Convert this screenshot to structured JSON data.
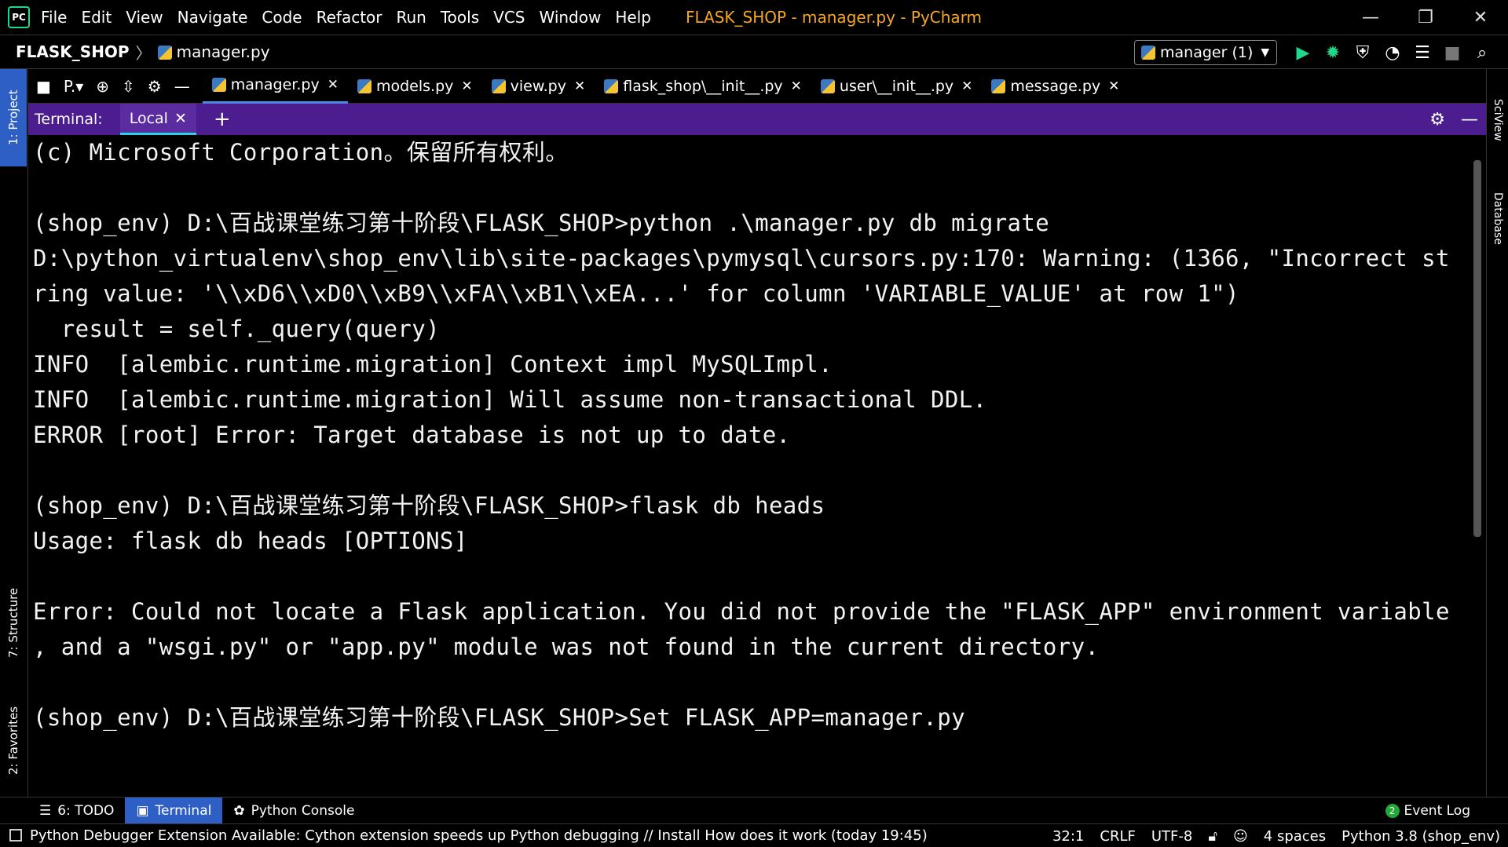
{
  "menubar": {
    "logo": "PC",
    "items": [
      "File",
      "Edit",
      "View",
      "Navigate",
      "Code",
      "Refactor",
      "Run",
      "Tools",
      "VCS",
      "Window",
      "Help"
    ],
    "window_title": "FLASK_SHOP - manager.py - PyCharm",
    "controls": [
      "—",
      "❐",
      "✕"
    ]
  },
  "navbar": {
    "project": "FLASK_SHOP",
    "separator": "〉",
    "file": "manager.py",
    "run_config": "manager (1)",
    "icons": [
      "run-icon",
      "debug-icon",
      "coverage-icon",
      "profile-icon",
      "build-icon",
      "stop-icon",
      "search-icon"
    ]
  },
  "left_stripe": {
    "project": "1: Project",
    "structure": "7: Structure",
    "favorites": "2: Favorites"
  },
  "right_stripe": {
    "sciview": "SciView",
    "database": "Database"
  },
  "tab_row": {
    "project_label": "P.▾",
    "tabs": [
      {
        "label": "manager.py",
        "active": true
      },
      {
        "label": "models.py",
        "active": false
      },
      {
        "label": "view.py",
        "active": false
      },
      {
        "label": "flask_shop\\__init__.py",
        "active": false
      },
      {
        "label": "user\\__init__.py",
        "active": false
      },
      {
        "label": "message.py",
        "active": false
      }
    ]
  },
  "terminal": {
    "label": "Terminal:",
    "tab": "Local",
    "lines": [
      "(c) Microsoft Corporation。保留所有权利。",
      "",
      "(shop_env) D:\\百战课堂练习第十阶段\\FLASK_SHOP>python .\\manager.py db migrate",
      "D:\\python_virtualenv\\shop_env\\lib\\site-packages\\pymysql\\cursors.py:170: Warning: (1366, \"Incorrect st",
      "ring value: '\\\\xD6\\\\xD0\\\\xB9\\\\xFA\\\\xB1\\\\xEA...' for column 'VARIABLE_VALUE' at row 1\")",
      "  result = self._query(query)",
      "INFO  [alembic.runtime.migration] Context impl MySQLImpl.",
      "INFO  [alembic.runtime.migration] Will assume non-transactional DDL.",
      "ERROR [root] Error: Target database is not up to date.",
      "",
      "(shop_env) D:\\百战课堂练习第十阶段\\FLASK_SHOP>flask db heads",
      "Usage: flask db heads [OPTIONS]",
      "",
      "Error: Could not locate a Flask application. You did not provide the \"FLASK_APP\" environment variable",
      ", and a \"wsgi.py\" or \"app.py\" module was not found in the current directory.",
      "",
      "(shop_env) D:\\百战课堂练习第十阶段\\FLASK_SHOP>Set FLASK_APP=manager.py"
    ]
  },
  "bottom_tools": {
    "todo": "6: TODO",
    "terminal": "Terminal",
    "python_console": "Python Console",
    "event_log": "Event Log",
    "event_count": "2"
  },
  "statusbar": {
    "message": "Python Debugger Extension Available: Cython extension speeds up Python debugging // Install   How does it work (today 19:45)",
    "position": "32:1",
    "line_sep": "CRLF",
    "encoding": "UTF-8",
    "indent": "4 spaces",
    "interpreter": "Python 3.8 (shop_env)"
  },
  "colors": {
    "accent_blue": "#2d5fc4",
    "terminal_header": "#4c1d8e",
    "title_orange": "#f5a623",
    "run_green": "#21d789"
  }
}
